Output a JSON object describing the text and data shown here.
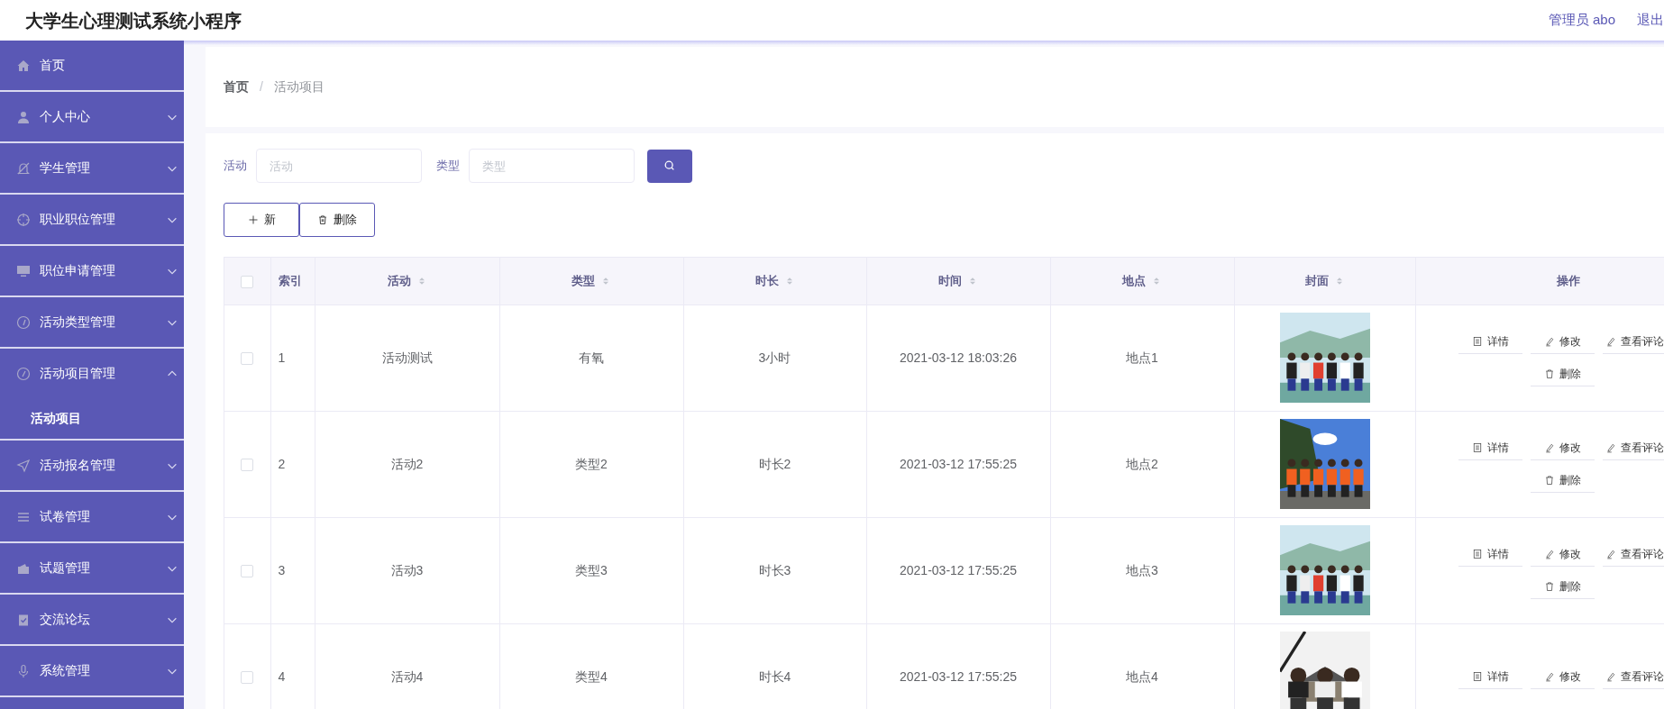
{
  "header": {
    "title": "大学生心理测试系统小程序",
    "user": "管理员 abo",
    "logout": "退出"
  },
  "sidebar": {
    "items": [
      {
        "label": "首页"
      },
      {
        "label": "个人中心",
        "expanded": false
      },
      {
        "label": "学生管理",
        "expanded": false
      },
      {
        "label": "职业职位管理",
        "expanded": false
      },
      {
        "label": "职位申请管理",
        "expanded": false
      },
      {
        "label": "活动类型管理",
        "expanded": false
      },
      {
        "label": "活动项目管理",
        "expanded": true,
        "children": [
          {
            "label": "活动项目",
            "selected": true
          }
        ]
      },
      {
        "label": "活动报名管理",
        "expanded": false
      },
      {
        "label": "试卷管理",
        "expanded": false
      },
      {
        "label": "试题管理",
        "expanded": false
      },
      {
        "label": "交流论坛",
        "expanded": false
      },
      {
        "label": "系统管理",
        "expanded": false
      }
    ]
  },
  "breadcrumb": [
    "首页",
    "活动项目"
  ],
  "breadcrumb_separator": "/",
  "search": {
    "fields": [
      {
        "label": "活动",
        "placeholder": "活动"
      },
      {
        "label": "类型",
        "placeholder": "类型"
      }
    ]
  },
  "actions": [
    {
      "kind": "add",
      "label": "新"
    },
    {
      "kind": "delete",
      "label": "删除"
    }
  ],
  "table": {
    "header_checked": false,
    "columns": [
      {
        "label": "索引",
        "sortable": false
      },
      {
        "label": "活动",
        "sortable": true
      },
      {
        "label": "类型",
        "sortable": true
      },
      {
        "label": "时长",
        "sortable": true
      },
      {
        "label": "时间",
        "sortable": true
      },
      {
        "label": "地点",
        "sortable": true
      },
      {
        "label": "封面",
        "sortable": true
      },
      {
        "label": "操作",
        "sortable": false
      }
    ],
    "rows": [
      {
        "checked": false,
        "cells": [
          "1",
          "活动测试",
          "有氧",
          "3小时",
          "2021-03-12 18:03:26",
          "地点1"
        ],
        "cover": {
          "kind": "picture"
        },
        "operations": [
          {
            "kind": "detail",
            "label": "详情"
          },
          {
            "kind": "edit",
            "label": "修改"
          },
          {
            "kind": "edit",
            "label": "查看评论"
          },
          {
            "kind": "delete",
            "label": "删除"
          }
        ]
      },
      {
        "checked": false,
        "cells": [
          "2",
          "活动2",
          "类型2",
          "时长2",
          "2021-03-12 17:55:25",
          "地点2"
        ],
        "cover": {
          "kind": "picture"
        },
        "operations": [
          {
            "kind": "detail",
            "label": "详情"
          },
          {
            "kind": "edit",
            "label": "修改"
          },
          {
            "kind": "edit",
            "label": "查看评论"
          },
          {
            "kind": "delete",
            "label": "删除"
          }
        ]
      },
      {
        "checked": false,
        "cells": [
          "3",
          "活动3",
          "类型3",
          "时长3",
          "2021-03-12 17:55:25",
          "地点3"
        ],
        "cover": {
          "kind": "picture"
        },
        "operations": [
          {
            "kind": "detail",
            "label": "详情"
          },
          {
            "kind": "edit",
            "label": "修改"
          },
          {
            "kind": "edit",
            "label": "查看评论"
          },
          {
            "kind": "delete",
            "label": "删除"
          }
        ]
      },
      {
        "checked": false,
        "cells": [
          "4",
          "活动4",
          "类型4",
          "时长4",
          "2021-03-12 17:55:25",
          "地点4"
        ],
        "cover": {
          "kind": "picture"
        },
        "operations": [
          {
            "kind": "detail",
            "label": "详情"
          },
          {
            "kind": "edit",
            "label": "修改"
          },
          {
            "kind": "edit",
            "label": "查看评论"
          }
        ]
      }
    ]
  }
}
